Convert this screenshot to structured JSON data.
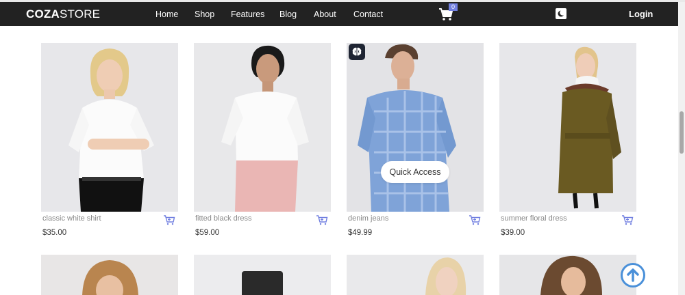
{
  "brand": {
    "bold": "COZA",
    "regular": "STORE"
  },
  "nav": {
    "links": [
      {
        "label": "Home"
      },
      {
        "label": "Shop"
      },
      {
        "label": "Features"
      },
      {
        "label": "Blog"
      },
      {
        "label": "About"
      },
      {
        "label": "Contact"
      }
    ],
    "cart_count": "0",
    "login_label": "Login"
  },
  "products": [
    {
      "name": "classic white shirt",
      "price": "$35.00"
    },
    {
      "name": "fitted black dress",
      "price": "$59.00"
    },
    {
      "name": "denim jeans",
      "price": "$49.99"
    },
    {
      "name": "summer floral dress",
      "price": "$39.00"
    }
  ],
  "quick_access_label": "Quick Access",
  "colors": {
    "navbar": "#222222",
    "accent": "#717fe0",
    "back_to_top": "#4a90d9"
  }
}
